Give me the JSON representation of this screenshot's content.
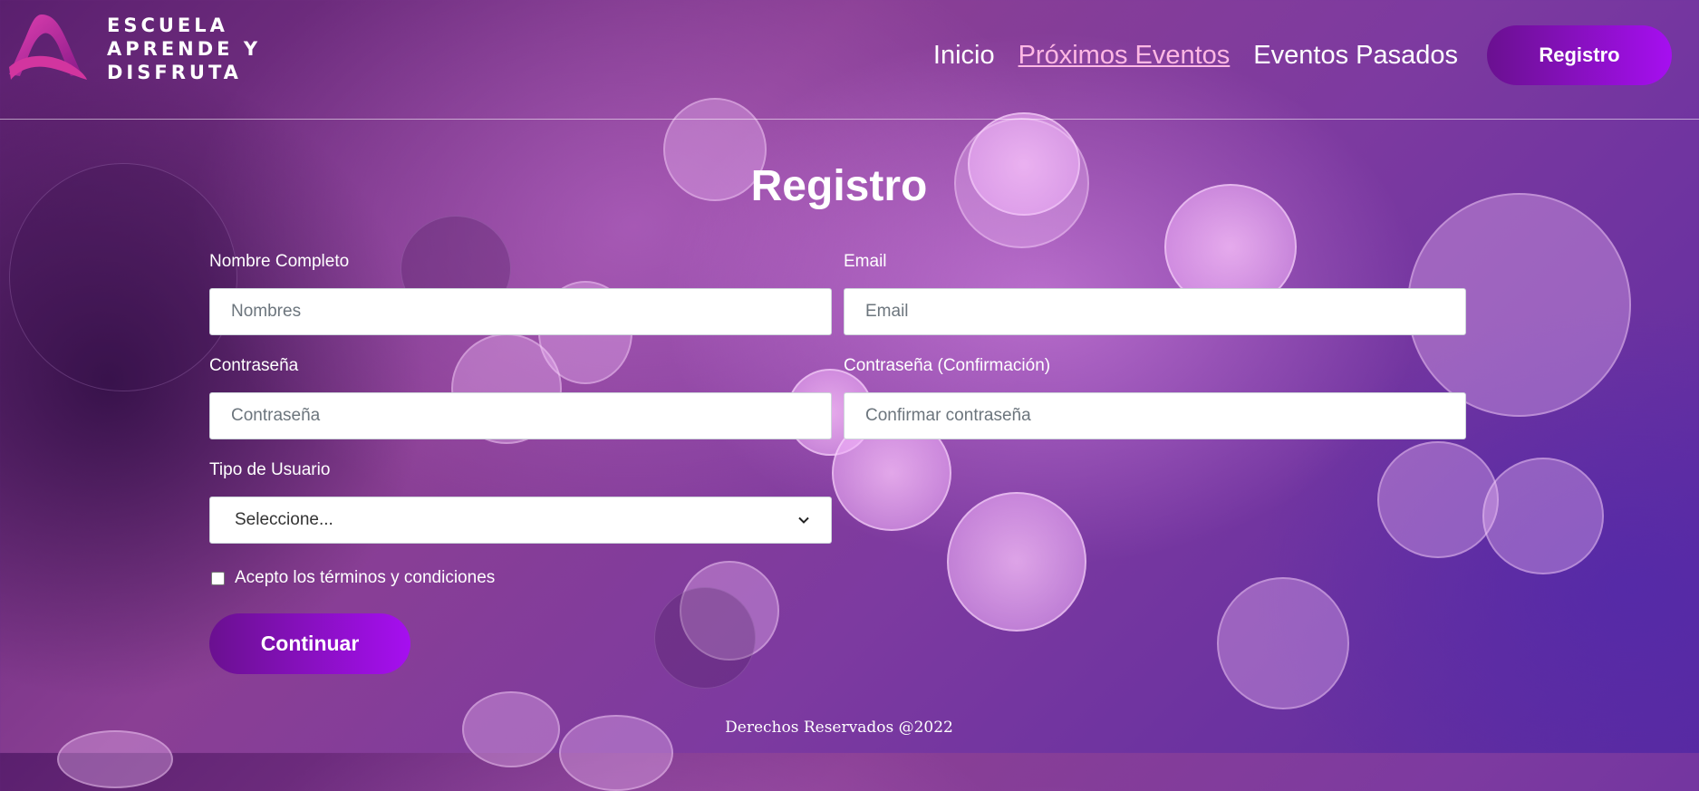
{
  "header": {
    "logo_lines": [
      "ESCUELA",
      "APRENDE Y",
      "DISFRUTA"
    ],
    "nav": [
      {
        "label": "Inicio"
      },
      {
        "label": "Próximos Eventos"
      },
      {
        "label": "Eventos Pasados"
      }
    ],
    "register_button": "Registro"
  },
  "page": {
    "title": "Registro"
  },
  "form": {
    "full_name": {
      "label": "Nombre Completo",
      "placeholder": "Nombres"
    },
    "email": {
      "label": "Email",
      "placeholder": "Email"
    },
    "password": {
      "label": "Contraseña",
      "placeholder": "Contraseña"
    },
    "password_confirm": {
      "label": "Contraseña (Confirmación)",
      "placeholder": "Confirmar contraseña"
    },
    "user_type": {
      "label": "Tipo de Usuario",
      "selected": "Seleccione..."
    },
    "terms": {
      "label": "Acepto los términos y condiciones",
      "checked": false
    },
    "submit": "Continuar"
  },
  "footer": {
    "text": "Derechos Reservados @2022"
  },
  "colors": {
    "accent_start": "#6a1090",
    "accent_end": "#a60ff0",
    "active_link": "#ffb8e4"
  }
}
